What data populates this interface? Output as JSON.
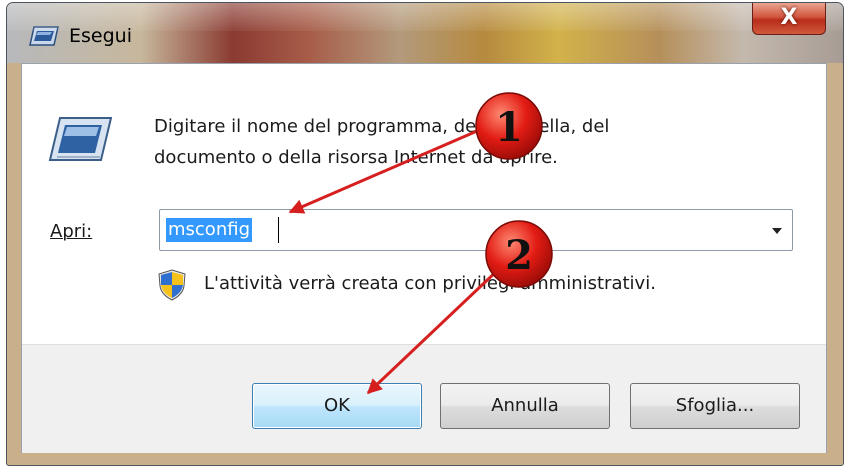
{
  "window": {
    "title": "Esegui",
    "close_glyph": "X"
  },
  "dialog": {
    "instructions_line1": "Digitare il nome del programma, della cartella, del",
    "instructions_line2": "documento o della risorsa Internet da aprire.",
    "open_label": "Apri:",
    "open_value": "msconfig",
    "admin_note": "L'attività verrà creata con privilegi amministrativi."
  },
  "buttons": {
    "ok": "OK",
    "cancel": "Annulla",
    "browse": "Sfoglia..."
  },
  "annotations": {
    "step1": "1",
    "step2": "2",
    "color": "#d62020"
  },
  "icons": {
    "title": "run-icon",
    "main": "run-icon",
    "shield": "uac-shield-icon",
    "close": "close-icon",
    "dropdown": "chevron-down-icon"
  }
}
